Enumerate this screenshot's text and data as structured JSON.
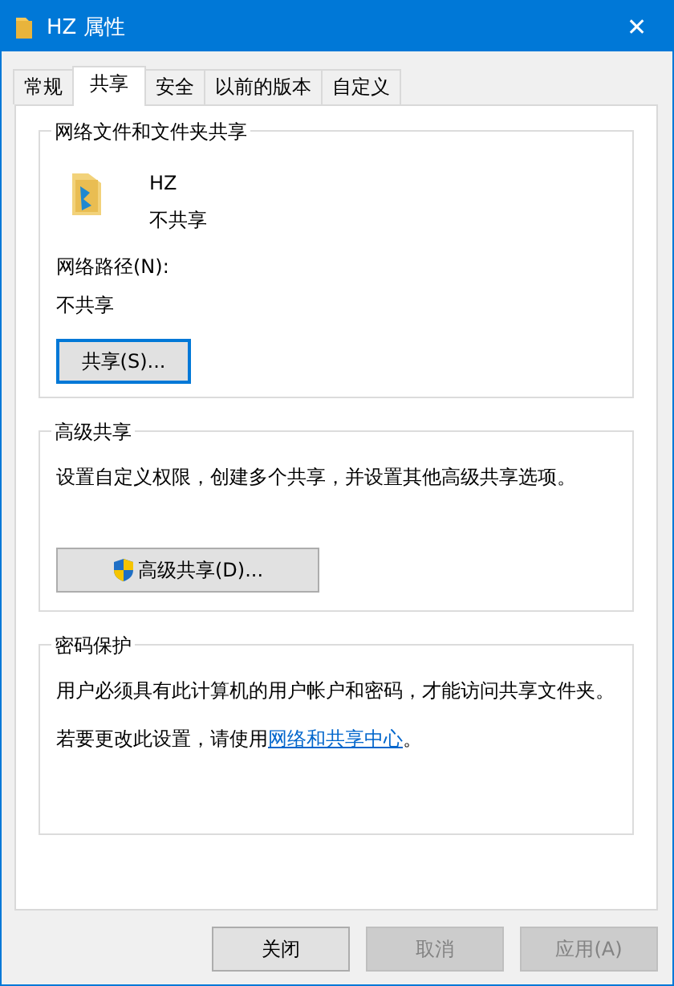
{
  "window": {
    "title": "HZ 属性",
    "close": "✕"
  },
  "tabs": [
    {
      "label": "常规",
      "selected": false
    },
    {
      "label": "共享",
      "selected": true
    },
    {
      "label": "安全",
      "selected": false
    },
    {
      "label": "以前的版本",
      "selected": false
    },
    {
      "label": "自定义",
      "selected": false
    }
  ],
  "network_sharing": {
    "title": "网络文件和文件夹共享",
    "folder_name": "HZ",
    "folder_status": "不共享",
    "path_label": "网络路径(N):",
    "path_value": "不共享",
    "button": {
      "label": "共享(S)...",
      "focused": true
    }
  },
  "advanced_sharing": {
    "title": "高级共享",
    "description": "设置自定义权限，创建多个共享，并设置其他高级共享选项。",
    "button": {
      "label": "高级共享(D)...",
      "focused": false
    }
  },
  "password_protection": {
    "title": "密码保护",
    "description": "用户必须具有此计算机的用户帐户和密码，才能访问共享文件夹。",
    "change_prefix": "若要更改此设置，请使用",
    "link": "网络和共享中心",
    "change_suffix": "。"
  },
  "buttons": [
    {
      "label": "关闭",
      "disabled": false
    },
    {
      "label": "取消",
      "disabled": true
    },
    {
      "label": "应用(A)",
      "disabled": true
    }
  ]
}
